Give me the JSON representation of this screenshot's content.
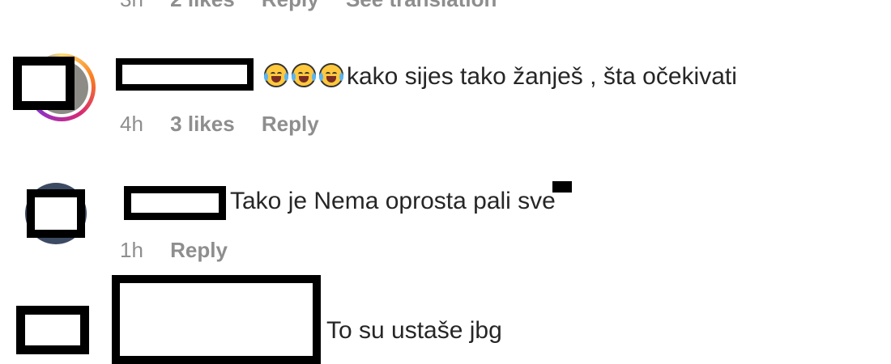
{
  "previous_comment": {
    "time": "3h",
    "likes": "2 likes",
    "reply": "Reply",
    "translate": "See translation"
  },
  "comments": [
    {
      "emoji": [
        "laughing-tears",
        "laughing-tears",
        "laughing-tears"
      ],
      "text": "kako sijes tako žanješ , šta očekivati",
      "time": "4h",
      "likes": "3 likes",
      "reply": "Reply"
    },
    {
      "text": "Tako je Nema oprosta pali sve",
      "time": "1h",
      "reply": "Reply"
    },
    {
      "text": "To su ustaše jbg"
    }
  ]
}
